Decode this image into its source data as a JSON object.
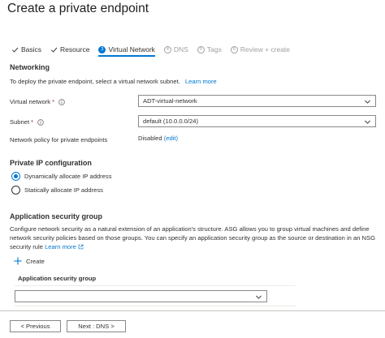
{
  "page": {
    "title": "Create a private endpoint"
  },
  "steps": [
    {
      "label": "Basics",
      "state": "done"
    },
    {
      "label": "Resource",
      "state": "done"
    },
    {
      "label": "Virtual Network",
      "number": "3",
      "state": "active"
    },
    {
      "label": "DNS",
      "number": "4",
      "state": "inactive"
    },
    {
      "label": "Tags",
      "number": "5",
      "state": "inactive"
    },
    {
      "label": "Review + create",
      "number": "6",
      "state": "inactive"
    }
  ],
  "networking": {
    "title": "Networking",
    "description": "To deploy the private endpoint, select a virtual network subnet.",
    "learn_more": "Learn more",
    "virtual_network": {
      "label": "Virtual network",
      "required": "*",
      "value": "ADT-virtual-network"
    },
    "subnet": {
      "label": "Subnet",
      "required": "*",
      "value": "default (10.0.0.0/24)"
    },
    "network_policy": {
      "label": "Network policy for private endpoints",
      "value": "Disabled",
      "edit": "(edit)"
    }
  },
  "ip_config": {
    "title": "Private IP configuration",
    "options": [
      {
        "label": "Dynamically allocate IP address",
        "selected": true
      },
      {
        "label": "Statically allocate IP address",
        "selected": false
      }
    ]
  },
  "asg": {
    "title": "Application security group",
    "description": "Configure network security as a natural extension of an application's structure. ASG allows you to group virtual machines and define network security policies based on those groups. You can specify an application security group as the source or destination in an NSG security rule",
    "learn_more": "Learn more",
    "create_label": "Create",
    "column_header": "Application security group",
    "dropdown_value": ""
  },
  "footer": {
    "previous": "< Previous",
    "next": "Next : DNS >"
  },
  "colors": {
    "accent": "#0078d4",
    "required": "#a4262c",
    "border": "#8a8886"
  }
}
